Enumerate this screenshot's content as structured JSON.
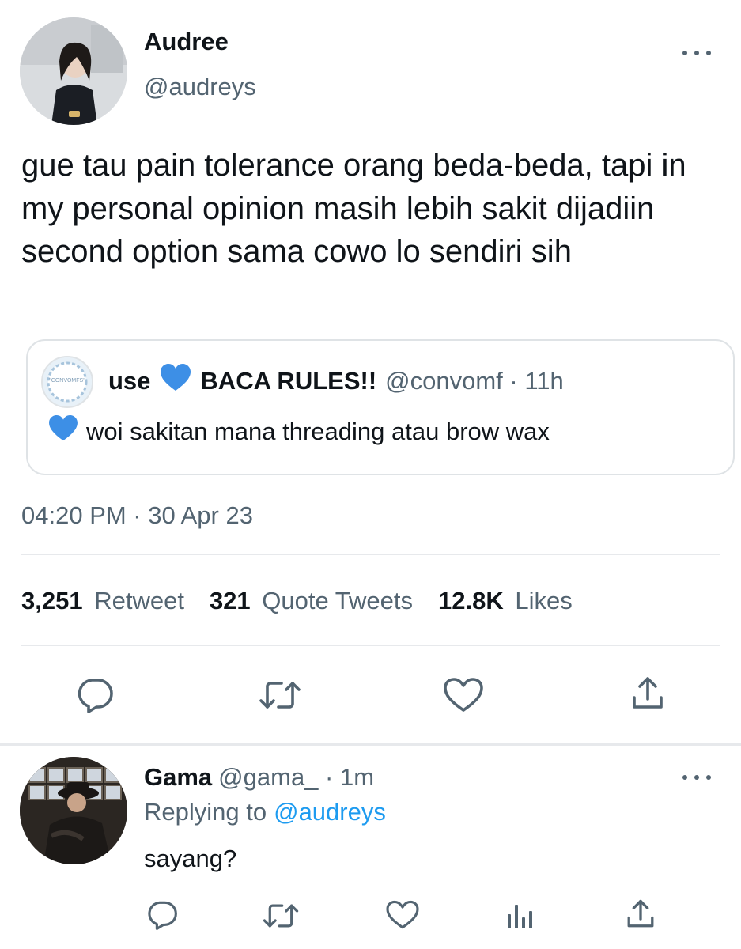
{
  "tweet": {
    "author_name": "Audree",
    "author_handle": "@audreys",
    "more_icon": "more-horizontal-icon",
    "text": "gue tau pain tolerance orang beda-beda, tapi in my personal opinion masih lebih sakit dijadiin second option sama cowo lo sendiri sih",
    "timestamp": "04:20 PM · 30 Apr 23",
    "quoted": {
      "avatar_text": "\"CONVOMFS\"",
      "name_prefix": "use",
      "name_suffix": "BACA RULES!!",
      "handle_time": "@convomf · 11h",
      "text": "woi sakitan mana threading atau brow wax",
      "heart_icon": "blue-heart-emoji"
    },
    "stats": {
      "retweets_count": "3,251",
      "retweets_label": "Retweet",
      "quotes_count": "321",
      "quotes_label": "Quote Tweets",
      "likes_count": "12.8K",
      "likes_label": "Likes"
    },
    "actions": [
      "reply-icon",
      "retweet-icon",
      "like-icon",
      "share-icon"
    ]
  },
  "reply": {
    "author_name": "Gama",
    "handle_time": "@gama_ · 1m",
    "replying_to_label": "Replying to",
    "replying_to_handle": "@audreys",
    "text": "sayang?",
    "actions": [
      "reply-icon",
      "retweet-icon",
      "like-icon",
      "analytics-icon",
      "share-icon"
    ]
  },
  "colors": {
    "accent": "#1d9bf0",
    "text": "#0f1419",
    "secondary": "#536471",
    "divider": "#e7e9ec"
  }
}
